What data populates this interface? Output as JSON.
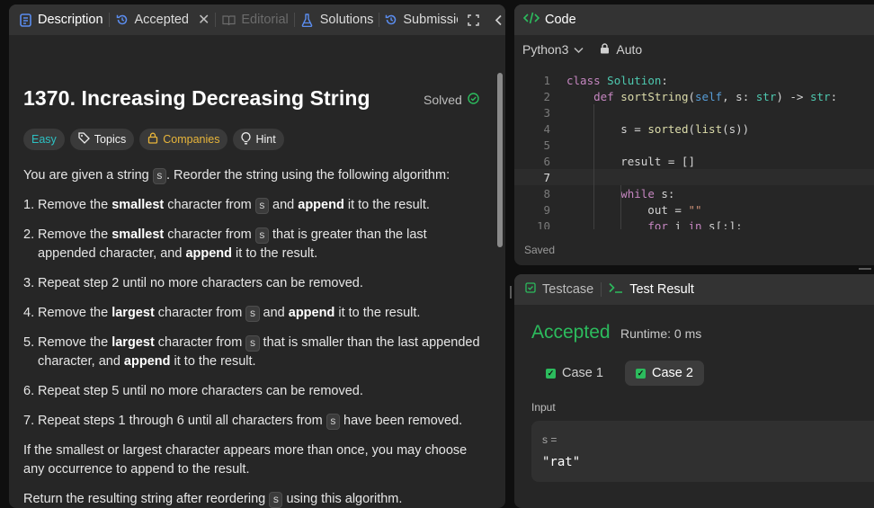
{
  "left_tabs": {
    "description": "Description",
    "accepted": "Accepted",
    "editorial": "Editorial",
    "solutions": "Solutions",
    "submissions": "Submissio"
  },
  "problem": {
    "title": "1370. Increasing Decreasing String",
    "status": "Solved",
    "chips": {
      "difficulty": "Easy",
      "topics": "Topics",
      "companies": "Companies",
      "hint": "Hint"
    },
    "intro_before": "You are given a string",
    "intro_code": "s",
    "intro_after": ". Reorder the string using the following algorithm:",
    "steps": [
      {
        "num": "1.",
        "a": "Remove the ",
        "b1": "smallest",
        "c": " character from ",
        "code": "s",
        "d": " and ",
        "b2": "append",
        "e": " it to the result."
      },
      {
        "num": "2.",
        "a": "Remove the ",
        "b1": "smallest",
        "c": " character from ",
        "code": "s",
        "d": " that is greater than the last appended character, and ",
        "b2": "append",
        "e": " it to the result."
      },
      {
        "num": "3.",
        "text": "Repeat step 2 until no more characters can be removed."
      },
      {
        "num": "4.",
        "a": "Remove the ",
        "b1": "largest",
        "c": " character from ",
        "code": "s",
        "d": " and ",
        "b2": "append",
        "e": " it to the result."
      },
      {
        "num": "5.",
        "a": "Remove the ",
        "b1": "largest",
        "c": " character from ",
        "code": "s",
        "d": " that is smaller than the last appended character, and ",
        "b2": "append",
        "e": " it to the result."
      },
      {
        "num": "6.",
        "text": "Repeat step 5 until no more characters can be removed."
      },
      {
        "num": "7.",
        "a": "Repeat steps 1 through 6 until all characters from ",
        "code": "s",
        "e": " have been removed."
      }
    ],
    "note": "If the smallest or largest character appears more than once, you may choose any occurrence to append to the result.",
    "return_before": "Return the resulting string after reordering",
    "return_code": "s",
    "return_after": " using this algorithm."
  },
  "code_panel": {
    "title": "Code",
    "language": "Python3",
    "mode": "Auto",
    "status": "Saved",
    "lines": [
      {
        "n": "1",
        "text": "class Solution:"
      },
      {
        "n": "2",
        "text": "    def sortString(self, s: str) -> str:"
      },
      {
        "n": "3",
        "text": ""
      },
      {
        "n": "4",
        "text": "        s = sorted(list(s))"
      },
      {
        "n": "5",
        "text": ""
      },
      {
        "n": "6",
        "text": "        result = []"
      },
      {
        "n": "7",
        "text": ""
      },
      {
        "n": "8",
        "text": "        while s:"
      },
      {
        "n": "9",
        "text": "            out = \"\""
      },
      {
        "n": "10",
        "text": "            for i in s[:]:"
      }
    ]
  },
  "result_panel": {
    "tab_testcase": "Testcase",
    "tab_result": "Test Result",
    "verdict": "Accepted",
    "runtime": "Runtime: 0 ms",
    "case1": "Case 1",
    "case2": "Case 2",
    "input_label": "Input",
    "input_var": "s =",
    "input_value": "\"rat\""
  },
  "colors": {
    "accent_green": "#2cbb5d",
    "easy": "#2dc0c2",
    "companies": "#e8b53a",
    "description_icon": "#5b8def"
  }
}
